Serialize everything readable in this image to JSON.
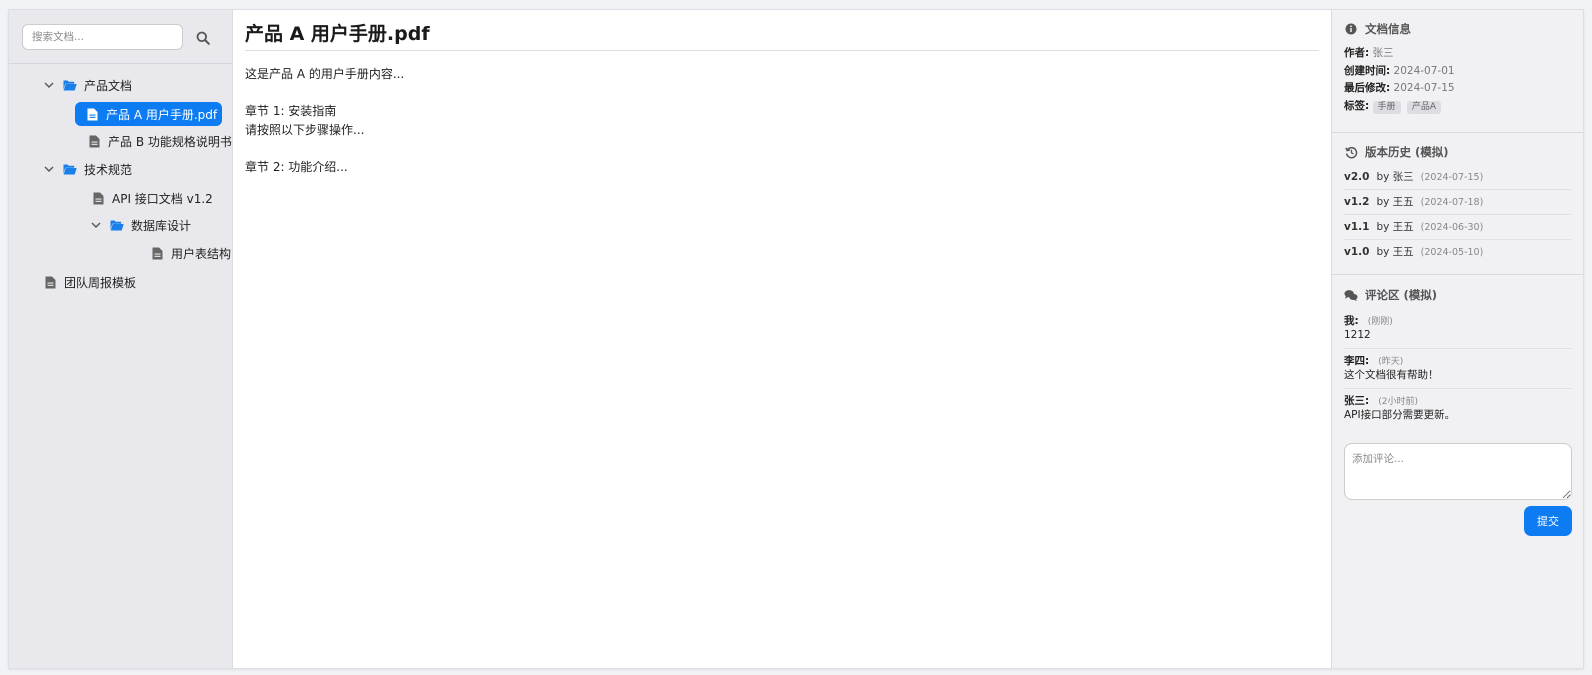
{
  "search": {
    "placeholder": "搜索文档..."
  },
  "tree": [
    {
      "label": "产品文档",
      "type": "folder"
    },
    {
      "label": "产品 A 用户手册.pdf",
      "type": "file",
      "active": true
    },
    {
      "label": "产品 B 功能规格说明书",
      "type": "file"
    },
    {
      "label": "技术规范",
      "type": "folder"
    },
    {
      "label": "API 接口文档 v1.2",
      "type": "file"
    },
    {
      "label": "数据库设计",
      "type": "folder"
    },
    {
      "label": "用户表结构",
      "type": "file"
    },
    {
      "label": "团队周报模板",
      "type": "file"
    }
  ],
  "doc": {
    "title": "产品 A 用户手册.pdf",
    "lines": [
      "这是产品 A 的用户手册内容...",
      "",
      "章节 1: 安装指南",
      "请按照以下步骤操作...",
      "",
      "章节 2: 功能介绍..."
    ]
  },
  "info": {
    "heading": "文档信息",
    "author_label": "作者:",
    "author": "张三",
    "created_label": "创建时间:",
    "created": "2024-07-01",
    "modified_label": "最后修改:",
    "modified": "2024-07-15",
    "tags_label": "标签:",
    "tags": [
      "手册",
      "产品A"
    ]
  },
  "history": {
    "heading": "版本历史 (模拟)",
    "versions": [
      {
        "version": "v2.0",
        "by": "by 张三",
        "date": "(2024-07-15)"
      },
      {
        "version": "v1.2",
        "by": "by 王五",
        "date": "(2024-07-18)"
      },
      {
        "version": "v1.1",
        "by": "by 王五",
        "date": "(2024-06-30)"
      },
      {
        "version": "v1.0",
        "by": "by 王五",
        "date": "(2024-05-10)"
      }
    ]
  },
  "comments": {
    "heading": "评论区 (模拟)",
    "items": [
      {
        "who": "我:",
        "when": "(刚刚)",
        "text": "1212"
      },
      {
        "who": "李四:",
        "when": "(昨天)",
        "text": "这个文档很有帮助！"
      },
      {
        "who": "张三:",
        "when": "(2小时前)",
        "text": "API接口部分需要更新。"
      }
    ],
    "placeholder": "添加评论...",
    "submit_label": "提交"
  },
  "colors": {
    "accent": "#0d7cf2",
    "folder": "#1a7fe8"
  }
}
